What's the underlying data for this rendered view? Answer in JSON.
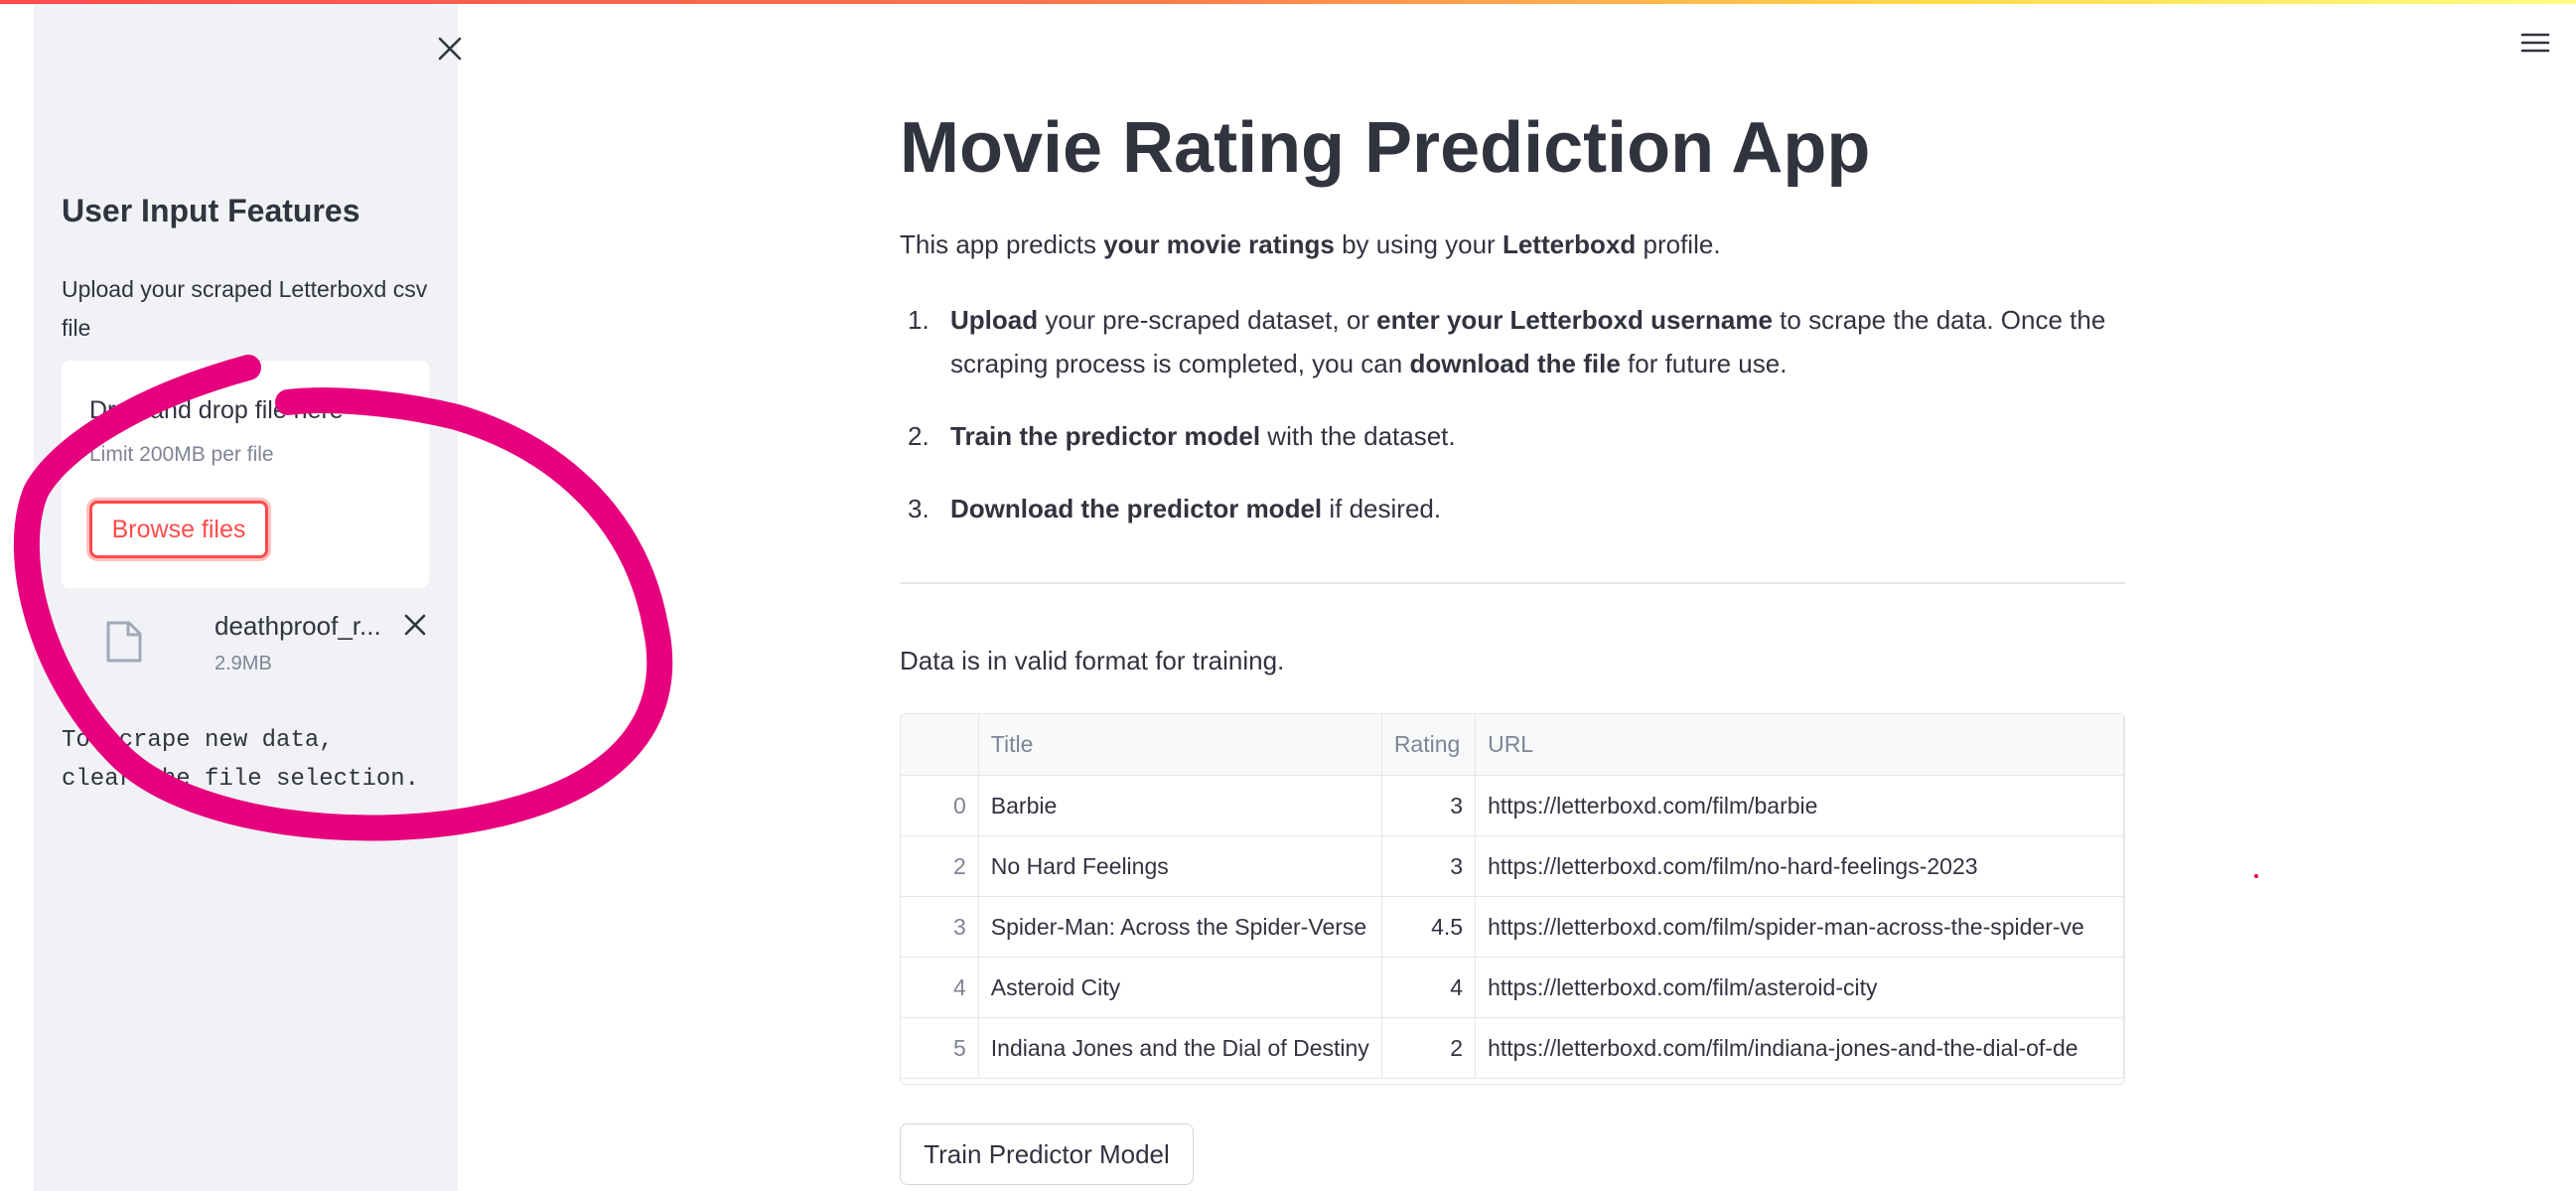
{
  "sidebar": {
    "heading": "User Input Features",
    "upload_label": "Upload your scraped Letterboxd csv file",
    "dropzone_title": "Drag and drop file here",
    "dropzone_limit": "Limit 200MB per file",
    "browse_button": "Browse files",
    "file_name": "deathproof_r...",
    "file_size": "2.9MB",
    "scrape_note": "To scrape new data,\nclear the file selection."
  },
  "main": {
    "title": "Movie Rating Prediction App",
    "intro": {
      "p1": "This app predicts ",
      "b1": "your movie ratings",
      "p2": " by using your ",
      "b2": "Letterboxd",
      "p3": " profile."
    },
    "steps": [
      {
        "num": "1.",
        "b1": "Upload",
        "t1": " your pre-scraped dataset, or ",
        "b2": "enter your Letterboxd username",
        "t2": " to scrape the data. Once the scraping process is completed, you can ",
        "b3": "download the file",
        "t3": " for future use."
      },
      {
        "num": "2.",
        "b1": "Train the predictor model",
        "t1": " with the dataset."
      },
      {
        "num": "3.",
        "b1": "Download the predictor model",
        "t1": " if desired."
      }
    ],
    "valid_message": "Data is in valid format for training.",
    "table": {
      "columns": [
        "",
        "Title",
        "Rating",
        "URL"
      ],
      "rows": [
        [
          "0",
          "Barbie",
          "3",
          "https://letterboxd.com/film/barbie"
        ],
        [
          "2",
          "No Hard Feelings",
          "3",
          "https://letterboxd.com/film/no-hard-feelings-2023"
        ],
        [
          "3",
          "Spider-Man: Across the Spider-Verse",
          "4.5",
          "https://letterboxd.com/film/spider-man-across-the-spider-ve"
        ],
        [
          "4",
          "Asteroid City",
          "4",
          "https://letterboxd.com/film/asteroid-city"
        ],
        [
          "5",
          "Indiana Jones and the Dial of Destiny",
          "2",
          "https://letterboxd.com/film/indiana-jones-and-the-dial-of-de"
        ]
      ]
    },
    "train_button": "Train Predictor Model"
  },
  "icons": {
    "close_sidebar": "close-icon",
    "file": "file-icon",
    "remove_file": "close-icon",
    "menu": "hamburger-menu-icon"
  },
  "colors": {
    "accent": "#ff4b4b",
    "sidebar_bg": "#f0f2f6",
    "annotation": "#e6007e"
  }
}
